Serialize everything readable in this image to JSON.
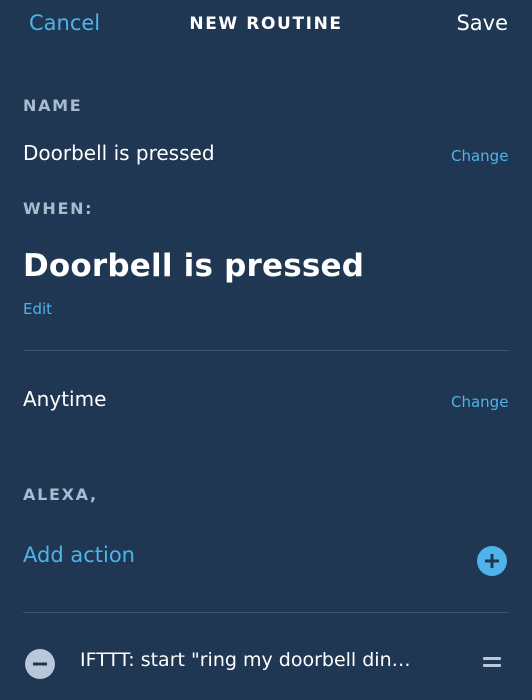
{
  "header": {
    "cancel_label": "Cancel",
    "title": "NEW ROUTINE",
    "save_label": "Save"
  },
  "name_section": {
    "label": "NAME",
    "value": "Doorbell is pressed",
    "change_label": "Change"
  },
  "when_section": {
    "label": "WHEN:",
    "trigger": "Doorbell is pressed",
    "edit_label": "Edit"
  },
  "schedule": {
    "value": "Anytime",
    "change_label": "Change"
  },
  "alexa_section": {
    "label": "ALEXA,",
    "add_action_label": "Add action",
    "actions": [
      {
        "text": "IFTTT: start \"ring my doorbell din…"
      }
    ]
  },
  "colors": {
    "background": "#1f3752",
    "accent": "#4fb3ea",
    "muted_label": "#a9bccf",
    "divider": "#3a5471"
  },
  "icons": {
    "add": "plus-circle-icon",
    "remove": "minus-circle-icon",
    "reorder": "drag-handle-icon"
  }
}
